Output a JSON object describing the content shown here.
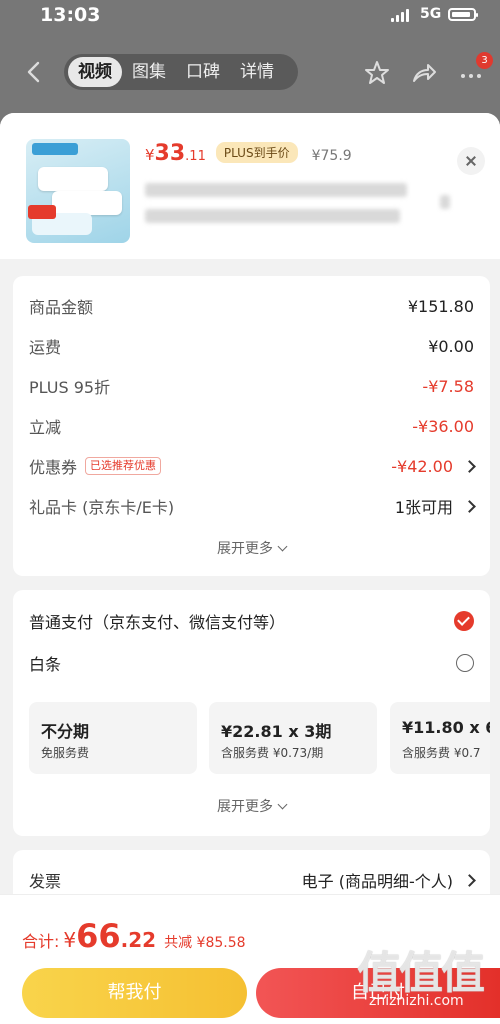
{
  "status_bar": {
    "time": "13:03",
    "network": "5G"
  },
  "top_nav": {
    "tabs": [
      "视频",
      "图集",
      "口碑",
      "详情"
    ],
    "active_tab": "视频",
    "more_badge": "3"
  },
  "product": {
    "price_symbol": "¥",
    "price_int": "33",
    "price_dec": ".11",
    "plus_tag": "PLUS到手价",
    "original_price": "¥75.9"
  },
  "summary": {
    "rows": [
      {
        "label": "商品金额",
        "value": "¥151.80"
      },
      {
        "label": "运费",
        "value": "¥0.00"
      },
      {
        "label": "PLUS 95折",
        "value": "-¥7.58"
      },
      {
        "label": "立减",
        "value": "-¥36.00"
      },
      {
        "label": "优惠券",
        "tag": "已选推荐优惠",
        "value": "-¥42.00"
      },
      {
        "label": "礼品卡 (京东卡/E卡)",
        "value": "1张可用"
      }
    ],
    "expand": "展开更多"
  },
  "payment": {
    "normal": "普通支付（京东支付、微信支付等）",
    "baitiao": "白条",
    "plans": [
      {
        "title": "不分期",
        "sub": "免服务费"
      },
      {
        "title": "¥22.81 x 3期",
        "sub": "含服务费 ¥0.73/期"
      },
      {
        "title": "¥11.80 x 6",
        "sub": "含服务费 ¥0.7"
      }
    ],
    "expand": "展开更多"
  },
  "invoice": {
    "label": "发票",
    "value": "电子 (商品明细-个人)"
  },
  "bottom": {
    "total_label": "合计:",
    "total_symbol": "¥",
    "total_int": "66",
    "total_dec": ".22",
    "savings": "共减 ¥85.58",
    "help_button": "帮我付",
    "self_button": "自己付"
  },
  "watermark": {
    "big": "值值值",
    "small": "zhizhizhi.com"
  },
  "colors": {
    "accent_red": "#e53b2c",
    "help_yellow": "#f5c032",
    "plus_bg": "#fbe7b9"
  }
}
